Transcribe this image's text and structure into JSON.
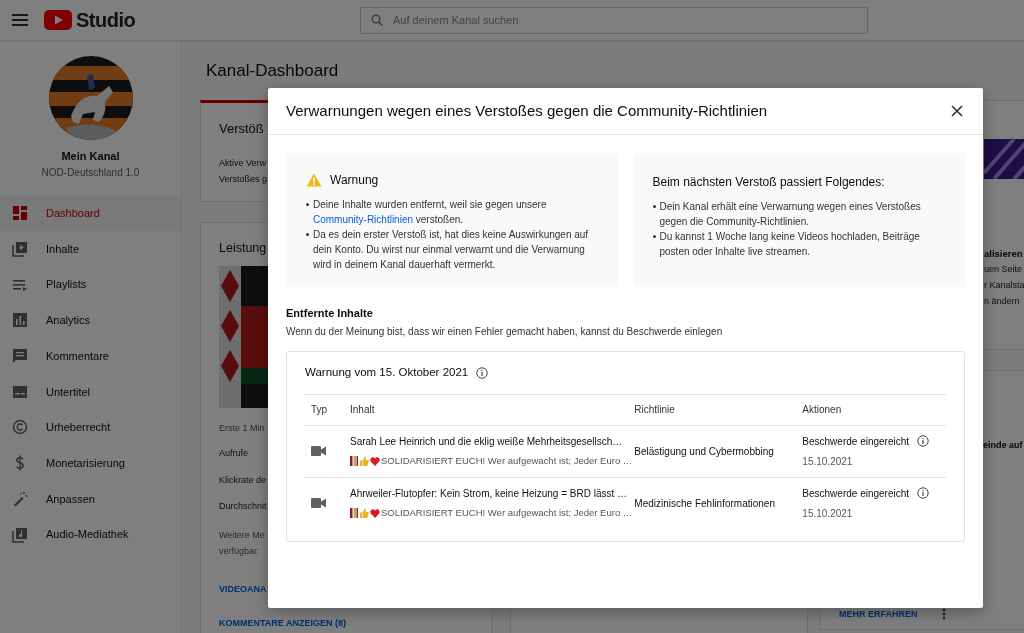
{
  "topbar": {
    "logo_text": "Studio",
    "search": {
      "placeholder": "Auf deinem Kanal suchen"
    }
  },
  "channel": {
    "title": "Mein Kanal",
    "name": "NOD-Deutschland 1.0"
  },
  "sidebar": {
    "items": [
      {
        "label": "Dashboard",
        "kind": "dashboard",
        "selected": true
      },
      {
        "label": "Inhalte",
        "kind": "content",
        "selected": false
      },
      {
        "label": "Playlists",
        "kind": "playlists",
        "selected": false
      },
      {
        "label": "Analytics",
        "kind": "analytics",
        "selected": false
      },
      {
        "label": "Kommentare",
        "kind": "comments",
        "selected": false
      },
      {
        "label": "Untertitel",
        "kind": "subtitles",
        "selected": false
      },
      {
        "label": "Urheberrecht",
        "kind": "copyright",
        "selected": false
      },
      {
        "label": "Monetarisierung",
        "kind": "money",
        "selected": false
      },
      {
        "label": "Anpassen",
        "kind": "customize",
        "selected": false
      },
      {
        "label": "Audio-Mediathek",
        "kind": "audio",
        "selected": false
      }
    ]
  },
  "dashboard": {
    "title": "Kanal-Dashboard",
    "violations_card": {
      "title": "Verstöß",
      "lines": [
        "Aktive Verw",
        "Verstoßes g"
      ]
    },
    "performance_card": {
      "title": "Leistung",
      "period": "Erste 1 Min",
      "metrics": [
        "Aufrufe",
        "Klickrate de",
        "Durchschnit"
      ],
      "note": [
        "Weitere Me",
        "verfügbar."
      ],
      "links": [
        "VIDEOANA",
        "KOMMENTARE ANZEIGEN (8)"
      ]
    },
    "customize_card": {
      "title": "alisieren",
      "lines": [
        "uen Seite",
        "r Kanalsta",
        "n ändern"
      ]
    },
    "news_card": {
      "title": "einde auf",
      "link": "MEHR ERFAHREN"
    }
  },
  "dialog": {
    "title": "Verwarnungen wegen eines Verstoßes gegen die Community-Richtlinien",
    "warning": {
      "heading": "Warnung",
      "bullets": [
        {
          "text": "Deine Inhalte wurden entfernt, weil sie gegen unsere ",
          "link": "Community-Richtlinien",
          "after": " verstoßen."
        },
        {
          "text": "Da es dein erster Verstoß ist, hat dies keine Auswirkungen auf dein Konto. Du wirst nur einmal verwarnt und die Verwarnung wird in deinem Kanal dauerhaft vermerkt."
        }
      ]
    },
    "next": {
      "heading": "Beim nächsten Verstoß passiert Folgendes:",
      "bullets": [
        "Dein Kanal erhält eine Verwarnung wegen eines Verstoßes gegen die Community-Richtlinien.",
        "Du kannst 1 Woche lang keine Videos hochladen, Beiträge posten oder Inhalte live streamen."
      ]
    },
    "removed": {
      "heading": "Entfernte Inhalte",
      "description": "Wenn du der Meinung bist, dass wir einen Fehler gemacht haben, kannst du Beschwerde einlegen"
    },
    "strike": {
      "title": "Warnung vom 15. Oktober 2021",
      "columns": [
        "Typ",
        "Inhalt",
        "Richtlinie",
        "Aktionen"
      ],
      "rows": [
        {
          "kind": "video",
          "title": "Sarah Lee Heinrich und die eklig weiße Mehrheitsgesellsch…",
          "description": "SOLIDARISIERT EUCH! Wer aufgewacht ist; Jeder Euro …",
          "policy": "Belästigung und Cybermobbing",
          "status": "Beschwerde eingereicht",
          "date": "15.10.2021"
        },
        {
          "kind": "video",
          "title": "Ahrweiler-Flutopfer: Kein Strom, keine Heizung = BRD lässt …",
          "description": "SOLIDARISIERT EUCH! Wer aufgewacht ist; Jeder Euro …",
          "policy": "Medizinische Fehlinformationen",
          "status": "Beschwerde eingereicht",
          "date": "15.10.2021"
        }
      ]
    }
  }
}
